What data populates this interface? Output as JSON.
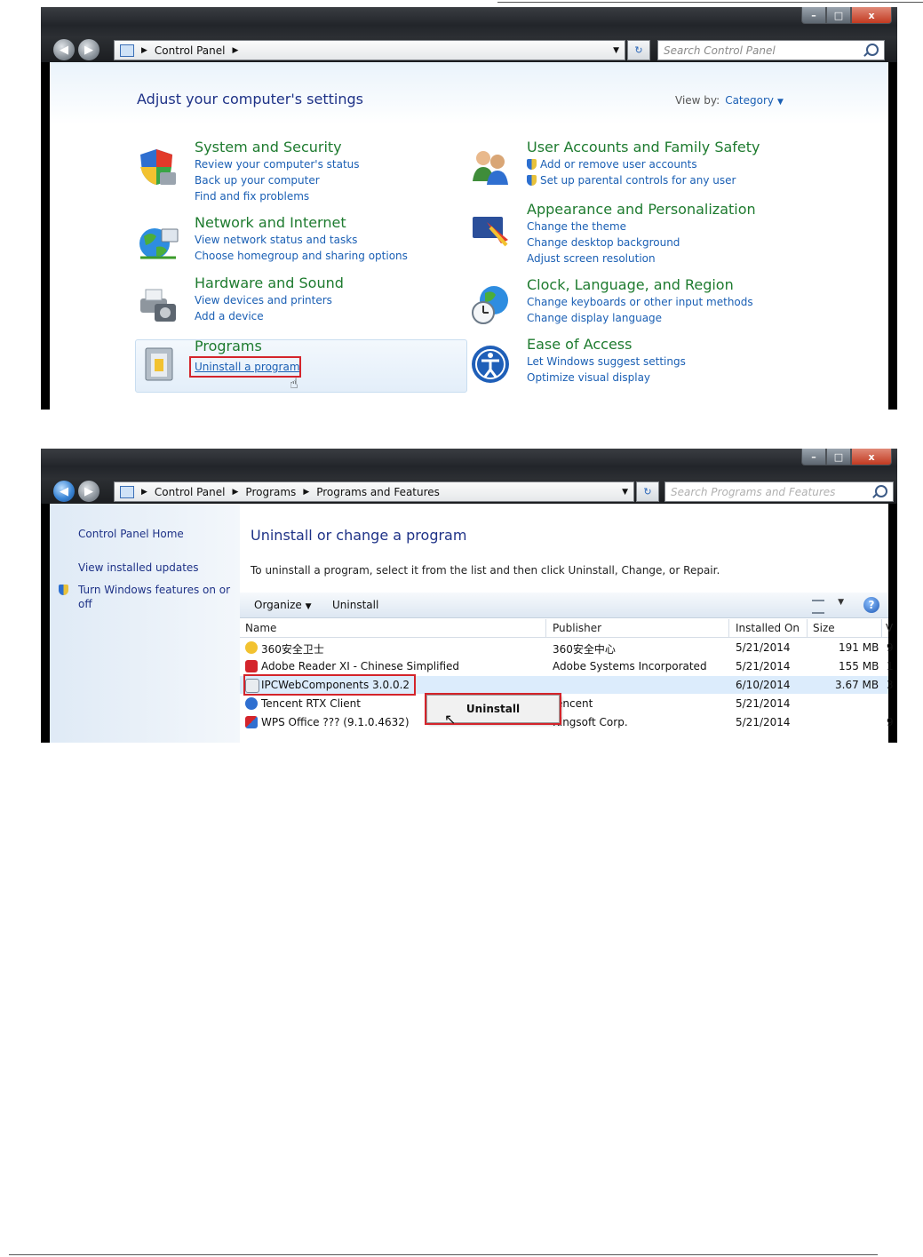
{
  "screen1": {
    "address": {
      "crumbs": [
        "Control Panel"
      ],
      "search_placeholder": "Search Control Panel"
    },
    "title": "Adjust your computer's settings",
    "view_by": {
      "label": "View by:",
      "value": "Category"
    },
    "categories": [
      {
        "title": "System and Security",
        "links": [
          "Review your computer's status",
          "Back up your computer",
          "Find and fix problems"
        ]
      },
      {
        "title": "Network and Internet",
        "links": [
          "View network status and tasks",
          "Choose homegroup and sharing options"
        ]
      },
      {
        "title": "Hardware and Sound",
        "links": [
          "View devices and printers",
          "Add a device"
        ]
      },
      {
        "title": "Programs",
        "links": [
          "Uninstall a program"
        ]
      },
      {
        "title": "User Accounts and Family Safety",
        "links": [
          "Add or remove user accounts",
          "Set up parental controls for any user"
        ]
      },
      {
        "title": "Appearance and Personalization",
        "links": [
          "Change the theme",
          "Change desktop background",
          "Adjust screen resolution"
        ]
      },
      {
        "title": "Clock, Language, and Region",
        "links": [
          "Change keyboards or other input methods",
          "Change display language"
        ]
      },
      {
        "title": "Ease of Access",
        "links": [
          "Let Windows suggest settings",
          "Optimize visual display"
        ]
      }
    ]
  },
  "screen2": {
    "address": {
      "crumbs": [
        "Control Panel",
        "Programs",
        "Programs and Features"
      ],
      "search_placeholder": "Search Programs and Features"
    },
    "sidebar": {
      "home": "Control Panel Home",
      "updates": "View installed updates",
      "features": "Turn Windows features on or off"
    },
    "title": "Uninstall or change a program",
    "description": "To uninstall a program, select it from the list and then click Uninstall, Change, or Repair.",
    "toolbar": {
      "organize": "Organize",
      "uninstall": "Uninstall"
    },
    "columns": [
      "Name",
      "Publisher",
      "Installed On",
      "Size"
    ],
    "rows": [
      {
        "name": "360安全卫士",
        "publisher": "360安全中心",
        "installed": "5/21/2014",
        "size": "191 MB",
        "extra": "9"
      },
      {
        "name": "Adobe Reader XI - Chinese Simplified",
        "publisher": "Adobe Systems Incorporated",
        "installed": "5/21/2014",
        "size": "155 MB",
        "extra": "1"
      },
      {
        "name": "IPCWebComponents 3.0.0.2",
        "publisher": "",
        "installed": "6/10/2014",
        "size": "3.67 MB",
        "extra": "3"
      },
      {
        "name": "Tencent RTX Client",
        "publisher": "encent",
        "installed": "5/21/2014",
        "size": "",
        "extra": ""
      },
      {
        "name": "WPS Office ??? (9.1.0.4632)",
        "publisher": "Kingsoft Corp.",
        "installed": "5/21/2014",
        "size": "",
        "extra": "9"
      }
    ],
    "context_menu": {
      "uninstall": "Uninstall"
    }
  },
  "colors": {
    "link": "#1a5fb4",
    "category_title": "#1e7b2f",
    "highlight": "#d4242b"
  }
}
